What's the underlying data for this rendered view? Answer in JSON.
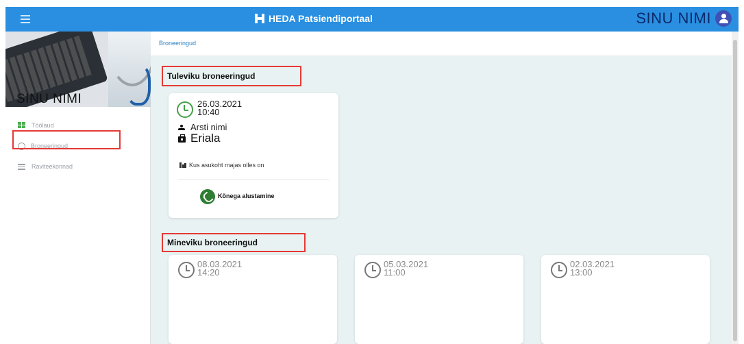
{
  "header": {
    "menu_icon": "hamburger-icon",
    "brand_icon": "heda-logo-icon",
    "title": "HEDA Patsiendiportaal",
    "user_name": "SINU NIMI",
    "avatar_icon": "user-avatar-icon",
    "color": "#2a8fe0"
  },
  "sidebar": {
    "hero_user_name": "SINU NIMI",
    "items": [
      {
        "label": "Töölaud",
        "icon": "dashboard-grid-icon"
      },
      {
        "label": "Broneeringud",
        "icon": "clock-icon",
        "highlighted": true
      },
      {
        "label": "Raviteekonnad",
        "icon": "list-icon"
      }
    ]
  },
  "breadcrumb": {
    "current": "Broneeringud"
  },
  "upcoming": {
    "title": "Tuleviku broneeringud",
    "card": {
      "date": "26.03.2021",
      "time": "10:40",
      "doctor": "Arsti nimi",
      "specialty": "Eriala",
      "location": "Kus asukoht majas olles on",
      "call_label": "Kõnega alustamine",
      "accent": "#43a047"
    }
  },
  "past": {
    "title": "Mineviku broneeringud",
    "cards": [
      {
        "date": "08.03.2021",
        "time": "14:20"
      },
      {
        "date": "05.03.2021",
        "time": "11:00"
      },
      {
        "date": "02.03.2021",
        "time": "13:00"
      }
    ]
  },
  "highlight_color": "#e53935"
}
